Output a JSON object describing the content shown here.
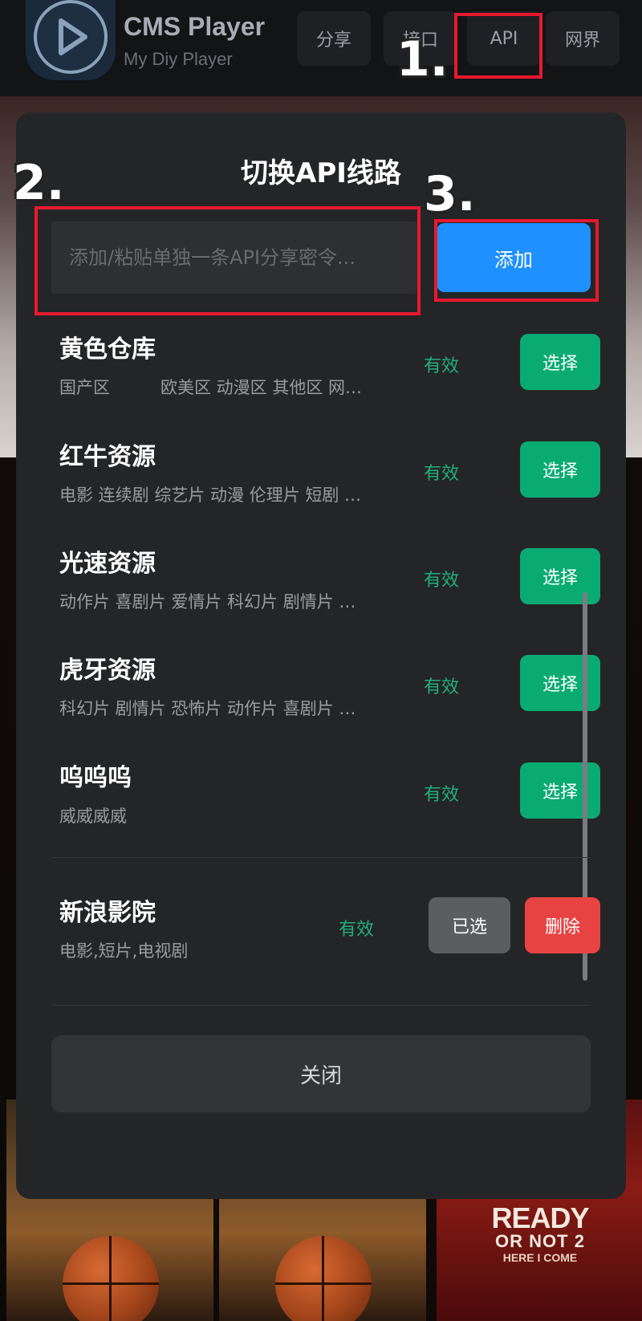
{
  "header": {
    "app_title": "CMS Player",
    "app_subtitle": "My Diy Player",
    "nav": [
      {
        "label": "分享"
      },
      {
        "label": "接口"
      },
      {
        "label": "API"
      },
      {
        "label": "网界"
      }
    ]
  },
  "annotations": {
    "step1": "1.",
    "step2": "2.",
    "step3": "3."
  },
  "modal": {
    "title": "切换API线路",
    "input_placeholder": "添加/粘贴单独一条API分享密令...",
    "input_value": "",
    "add_label": "添加",
    "select_label": "选择",
    "chosen_label": "已选",
    "delete_label": "删除",
    "close_label": "关闭",
    "sources": [
      {
        "name": "黄色仓库",
        "categories": "国产区　　　欧美区 动漫区 其他区 网…",
        "status": "有效"
      },
      {
        "name": "红牛资源",
        "categories": "电影 连续剧 综艺片 动漫 伦理片 短剧 …",
        "status": "有效"
      },
      {
        "name": "光速资源",
        "categories": "动作片 喜剧片 爱情片 科幻片 剧情片 …",
        "status": "有效"
      },
      {
        "name": "虎牙资源",
        "categories": "科幻片 剧情片 恐怖片 动作片 喜剧片 …",
        "status": "有效"
      },
      {
        "name": "呜呜呜",
        "categories": "威威威威",
        "status": "有效"
      }
    ],
    "current_source": {
      "name": "新浪影院",
      "categories": "电影,短片,电视剧",
      "status": "有效"
    }
  },
  "background": {
    "poster_title_line1": "READY",
    "poster_title_line2": "OR NOT 2",
    "poster_title_line3": "HERE I COME"
  },
  "colors": {
    "accent_blue": "#1e90ff",
    "select_green": "#0aab73",
    "valid_green": "#1fb07c",
    "delete_red": "#e84343",
    "annotation_red": "#e8192f"
  }
}
